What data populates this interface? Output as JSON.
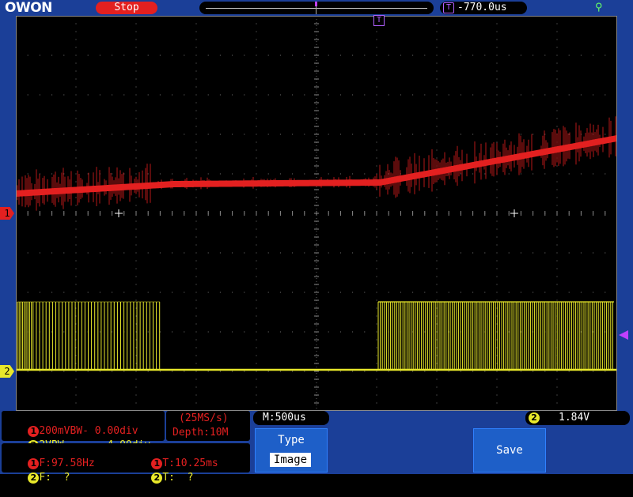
{
  "header": {
    "logo": "OWON",
    "status": "Stop",
    "trigger_position": "-770.0us"
  },
  "icons": {
    "usb": "usb-icon",
    "trigger_t": "T",
    "ch1_marker": "1",
    "ch2_marker": "2"
  },
  "channels": {
    "ch1": {
      "num": "1",
      "scale": "200mV",
      "bw": "BW-",
      "offset": "0.00div",
      "color": "#e32020"
    },
    "ch2": {
      "num": "2",
      "scale": "2V",
      "bw": "BW-",
      "offset": "-4.00div",
      "color": "#e8e82a"
    }
  },
  "acquisition": {
    "rate": "(25MS/s)",
    "depth": "Depth:10M",
    "timebase": "M:500us"
  },
  "trigger": {
    "channel": "2",
    "level": "1.84V"
  },
  "measurements": {
    "ch1_freq": "F:97.58Hz",
    "ch1_period": "T:10.25ms",
    "ch2_freq": "F:  ?",
    "ch2_period": "T:  ?"
  },
  "menu": {
    "type_label": "Type",
    "type_value": "Image",
    "save_label": "Save"
  },
  "colors": {
    "accent_blue": "#1b3f98",
    "ch1": "#e32020",
    "ch2": "#e8e82a",
    "trigger": "#c040ff"
  }
}
